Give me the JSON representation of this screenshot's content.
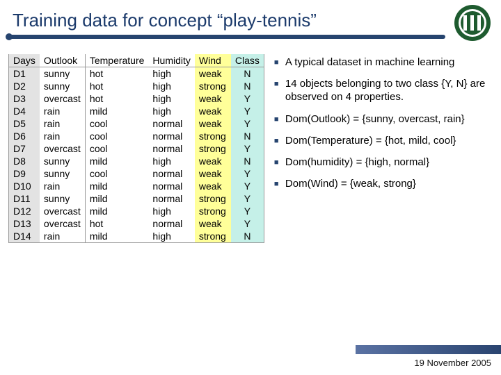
{
  "title": "Training data for concept “play-tennis”",
  "table": {
    "headers": [
      "Days",
      "Outlook",
      "Temperature",
      "Humidity",
      "Wind",
      "Class"
    ],
    "rows": [
      [
        "D1",
        "sunny",
        "hot",
        "high",
        "weak",
        "N"
      ],
      [
        "D2",
        "sunny",
        "hot",
        "high",
        "strong",
        "N"
      ],
      [
        "D3",
        "overcast",
        "hot",
        "high",
        "weak",
        "Y"
      ],
      [
        "D4",
        "rain",
        "mild",
        "high",
        "weak",
        "Y"
      ],
      [
        "D5",
        "rain",
        "cool",
        "normal",
        "weak",
        "Y"
      ],
      [
        "D6",
        "rain",
        "cool",
        "normal",
        "strong",
        "N"
      ],
      [
        "D7",
        "overcast",
        "cool",
        "normal",
        "strong",
        "Y"
      ],
      [
        "D8",
        "sunny",
        "mild",
        "high",
        "weak",
        "N"
      ],
      [
        "D9",
        "sunny",
        "cool",
        "normal",
        "weak",
        "Y"
      ],
      [
        "D10",
        "rain",
        "mild",
        "normal",
        "weak",
        "Y"
      ],
      [
        "D11",
        "sunny",
        "mild",
        "normal",
        "strong",
        "Y"
      ],
      [
        "D12",
        "overcast",
        "mild",
        "high",
        "strong",
        "Y"
      ],
      [
        "D13",
        "overcast",
        "hot",
        "normal",
        "weak",
        "Y"
      ],
      [
        "D14",
        "rain",
        "mild",
        "high",
        "strong",
        "N"
      ]
    ]
  },
  "bullets": [
    "A typical dataset in machine learning",
    "14 objects belonging to two class {Y, N} are observed on 4 properties.",
    "Dom(Outlook) = {sunny, overcast, rain}",
    "Dom(Temperature) = {hot, mild, cool}",
    "Dom(humidity) = {high, normal}",
    "Dom(Wind) = {weak, strong}"
  ],
  "footer_date": "19 November 2005"
}
